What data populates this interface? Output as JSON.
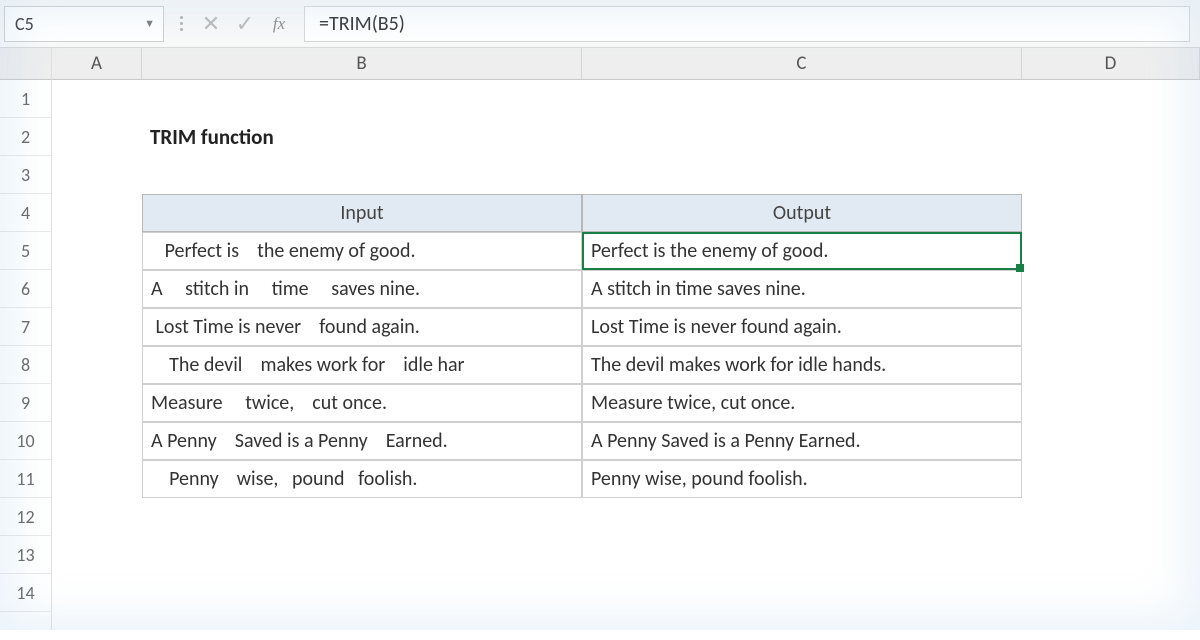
{
  "name_box": {
    "value": "C5"
  },
  "formula_bar": {
    "formula": "=TRIM(B5)"
  },
  "columns": {
    "A": "A",
    "B": "B",
    "C": "C",
    "D": "D"
  },
  "row_labels": [
    "1",
    "2",
    "3",
    "4",
    "5",
    "6",
    "7",
    "8",
    "9",
    "10",
    "11",
    "12",
    "13",
    "14"
  ],
  "title": "TRIM function",
  "header_row": {
    "input": "Input",
    "output": "Output"
  },
  "rows": [
    {
      "input": "   Perfect is    the enemy of good.",
      "output": "Perfect is the enemy of good."
    },
    {
      "input": "A     stitch in     time     saves nine.",
      "output": "A stitch in time saves nine."
    },
    {
      "input": " Lost Time is never    found again.",
      "output": "Lost Time is never found again."
    },
    {
      "input": "    The devil    makes work for    idle har",
      "output": "The devil makes work for idle hands."
    },
    {
      "input": "Measure     twice,    cut once.",
      "output": "Measure twice, cut once."
    },
    {
      "input": "A Penny    Saved is a Penny    Earned.",
      "output": "A Penny Saved is a Penny Earned."
    },
    {
      "input": "    Penny    wise,   pound   foolish.",
      "output": "Penny wise, pound foolish."
    }
  ],
  "selected": {
    "row": 5,
    "col": "C"
  }
}
